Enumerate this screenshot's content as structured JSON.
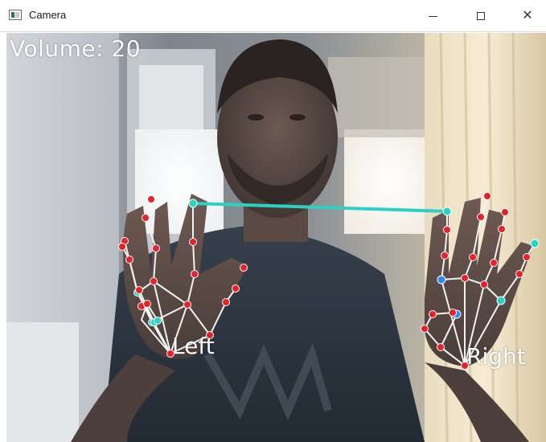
{
  "window": {
    "title": "Camera",
    "icon": "camera-window-icon",
    "controls": {
      "minimize_icon": "minimize-icon",
      "maximize_icon": "maximize-icon",
      "close_icon": "close-icon",
      "close_glyph": "✕"
    }
  },
  "overlay": {
    "volume_text": "Volume: 20",
    "left_label": "Left",
    "right_label": "Right"
  },
  "colors": {
    "landmark_red": "#e8202a",
    "landmark_cyan": "#29d3c2",
    "landmark_blue": "#2a8cf0",
    "connector_line": "#2cd1c5",
    "skeleton_line": "#f2f2f2"
  }
}
